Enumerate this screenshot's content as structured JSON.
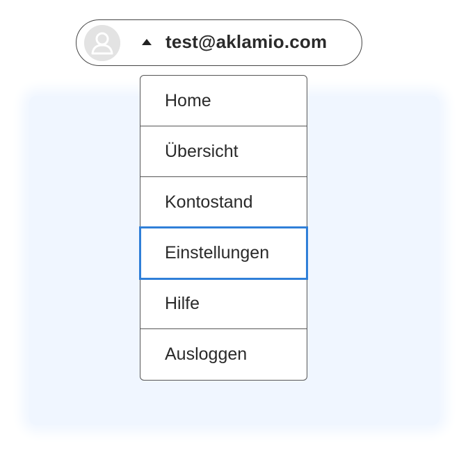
{
  "user_menu": {
    "email": "test@aklamio.com",
    "avatar_icon": "user-avatar-icon",
    "caret_icon": "caret-up-icon",
    "expanded": true
  },
  "menu": {
    "items": [
      {
        "label": "Home"
      },
      {
        "label": "Übersicht"
      },
      {
        "label": "Kontostand"
      },
      {
        "label": "Einstellungen",
        "focused": true
      },
      {
        "label": "Hilfe"
      },
      {
        "label": "Ausloggen"
      }
    ]
  },
  "colors": {
    "focus_outline": "#2f7fd8",
    "backdrop": "#f0f6ff",
    "border": "#555555",
    "avatar_bg": "#e3e3e3"
  }
}
